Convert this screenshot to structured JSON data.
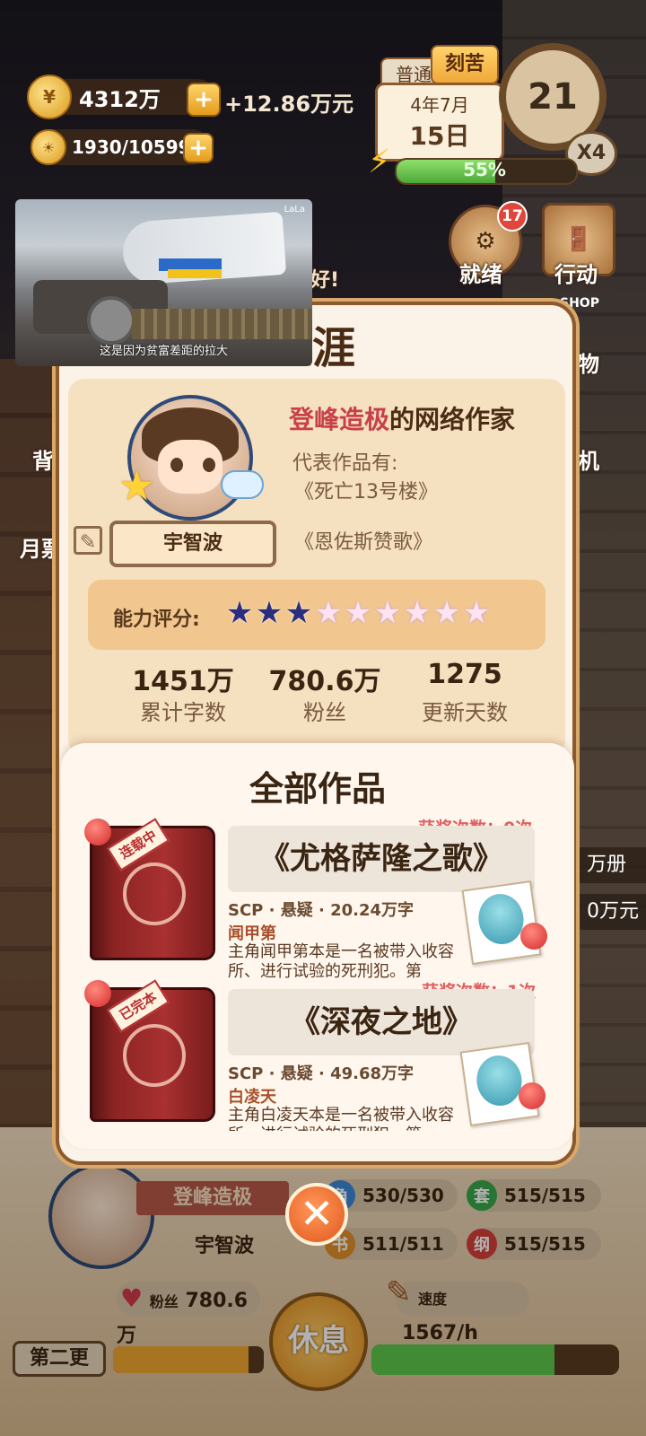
{
  "hud": {
    "coins": "4312万",
    "coin_rate": "+12.86万元",
    "inspiration": "1930/10599",
    "mode_normal": "普通",
    "mode_hard": "刻苦",
    "date_year_month": "4年7月",
    "date_day": "15日",
    "clock_value": "21",
    "speed": "X4",
    "energy_percent_text": "55%",
    "energy_fraction": 0.55
  },
  "side_buttons": {
    "ready_label": "就绪",
    "ready_badge": "17",
    "action_label": "行动",
    "shop_sign": "SHOP",
    "shop_label_partial": "物",
    "phone_label_partial": "机",
    "backpack_partial": "背",
    "monthly_partial": "月票",
    "bg_text_greeting": "好!",
    "bg_books": "万册",
    "bg_money": "0万元"
  },
  "video": {
    "caption": "这是因为贫富差距的拉大",
    "watermark": "LaLa"
  },
  "modal": {
    "title": "生涯",
    "rank_highlight": "登峰造极",
    "rank_suffix": "的网络作家",
    "rep_label": "代表作品有:",
    "rep_works": [
      "《死亡13号楼》",
      "《恩佐斯赞歌》"
    ],
    "player_name": "宇智波",
    "ability_label": "能力评分:",
    "ability_stars_filled": 3,
    "ability_stars_total": 9,
    "stats": [
      {
        "value": "1451万",
        "label": "累计字数"
      },
      {
        "value": "780.6万",
        "label": "粉丝"
      },
      {
        "value": "1275",
        "label": "更新天数"
      }
    ],
    "works_title": "全部作品",
    "works": [
      {
        "title": "《尤格萨隆之歌》",
        "award": "获奖次数：0次",
        "status_tag": "连载中",
        "meta": "SCP · 悬疑 · 20.24万字",
        "hero": "闻甲第",
        "desc": "主角闻甲第本是一名被带入收容所、进行试验的死刑犯。第"
      },
      {
        "title": "《深夜之地》",
        "award": "获奖次数：1次",
        "status_tag": "已完本",
        "meta": "SCP · 悬疑 · 49.68万字",
        "hero": "白凌天",
        "desc": "主角白凌天本是一名被带入收容所、进行试验的死刑犯。第"
      }
    ]
  },
  "bottom": {
    "rank": "登峰造极",
    "name": "宇智波",
    "attrs": [
      {
        "icon": "角",
        "value": "530/530",
        "color": "#3a8ad6"
      },
      {
        "icon": "套",
        "value": "515/515",
        "color": "#3aa84a"
      },
      {
        "icon": "书",
        "value": "511/511",
        "color": "#e0902a"
      },
      {
        "icon": "纲",
        "value": "515/515",
        "color": "#d6403a"
      }
    ],
    "fans_label": "粉丝",
    "fans_value": "780.6万",
    "speed_label": "速度",
    "speed_value": "1567/h",
    "rest_label": "休息",
    "chapter_label": "第二更"
  }
}
